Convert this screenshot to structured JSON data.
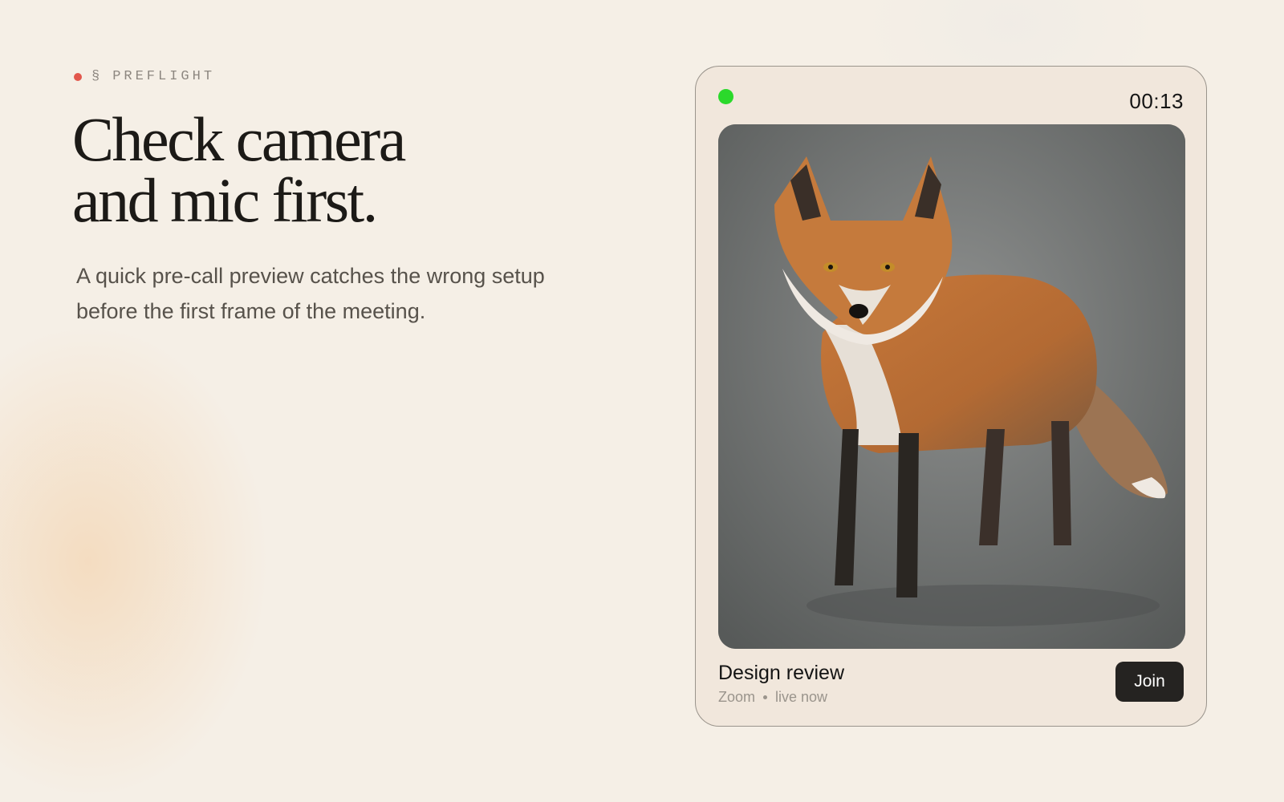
{
  "section": {
    "marker": "§",
    "label": "PREFLIGHT",
    "dot_color": "#e2574c"
  },
  "hero": {
    "headline_lines": [
      "Check camera",
      "and mic first."
    ],
    "lede_lines": [
      "A quick pre-call preview catches the wrong setup",
      "before the first frame of the meeting."
    ]
  },
  "card": {
    "status_color": "#2bd92b",
    "timer": "00:13",
    "preview_icon": "camera-preview-fox",
    "meeting": {
      "title": "Design review",
      "app": "Zoom",
      "status": "live now"
    },
    "join_label": "Join"
  }
}
